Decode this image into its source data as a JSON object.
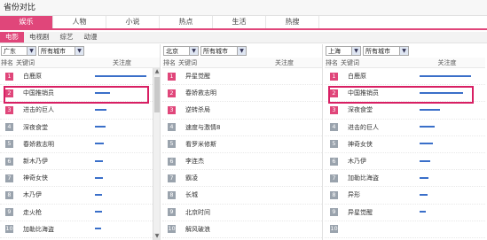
{
  "window": {
    "title": "省份对比"
  },
  "category_tabs": [
    {
      "label": "娱乐",
      "active": true
    },
    {
      "label": "人物",
      "active": false
    },
    {
      "label": "小说",
      "active": false
    },
    {
      "label": "热点",
      "active": false
    },
    {
      "label": "生活",
      "active": false
    },
    {
      "label": "热搜",
      "active": false
    }
  ],
  "sub_tabs": [
    {
      "label": "电影",
      "active": true
    },
    {
      "label": "电视剧",
      "active": false
    },
    {
      "label": "综艺",
      "active": false
    },
    {
      "label": "动漫",
      "active": false
    }
  ],
  "table_headers": {
    "rank": "排名",
    "keyword": "关键词",
    "attention": "关注度"
  },
  "colors": {
    "accent": "#e0467a",
    "bar": "#3a6fc9",
    "highlight": "#d81f63"
  },
  "panels": [
    {
      "province": "广东",
      "city": "所有城市",
      "has_scrollbar": true,
      "highlight_row": 1,
      "rows": [
        {
          "rank": "1",
          "keyword": "白鹿原",
          "attention": 1.0
        },
        {
          "rank": "2",
          "keyword": "中国推销员",
          "attention": 0.3
        },
        {
          "rank": "3",
          "keyword": "进击的巨人",
          "attention": 0.22
        },
        {
          "rank": "4",
          "keyword": "深夜食堂",
          "attention": 0.2
        },
        {
          "rank": "5",
          "keyword": "春娇救志明",
          "attention": 0.18
        },
        {
          "rank": "6",
          "keyword": "新木乃伊",
          "attention": 0.16
        },
        {
          "rank": "7",
          "keyword": "神奇女侠",
          "attention": 0.15
        },
        {
          "rank": "8",
          "keyword": "木乃伊",
          "attention": 0.14
        },
        {
          "rank": "9",
          "keyword": "走火枪",
          "attention": 0.13
        },
        {
          "rank": "10",
          "keyword": "加勒比海盗",
          "attention": 0.12
        }
      ]
    },
    {
      "province": "北京",
      "city": "所有城市",
      "has_scrollbar": false,
      "highlight_row": null,
      "rows": [
        {
          "rank": "1",
          "keyword": "异星觉醒",
          "attention": 0.0
        },
        {
          "rank": "2",
          "keyword": "春娇救志明",
          "attention": 0.0
        },
        {
          "rank": "3",
          "keyword": "逆转杀局",
          "attention": 0.0
        },
        {
          "rank": "4",
          "keyword": "速度与激情8",
          "attention": 0.0
        },
        {
          "rank": "5",
          "keyword": "看罗米修斯",
          "attention": 0.0
        },
        {
          "rank": "6",
          "keyword": "李连杰",
          "attention": 0.0
        },
        {
          "rank": "7",
          "keyword": "霸凌",
          "attention": 0.0
        },
        {
          "rank": "8",
          "keyword": "长城",
          "attention": 0.0
        },
        {
          "rank": "9",
          "keyword": "北京时间",
          "attention": 0.0
        },
        {
          "rank": "10",
          "keyword": "解风破浪",
          "attention": 0.0
        }
      ]
    },
    {
      "province": "上海",
      "city": "所有城市",
      "has_scrollbar": false,
      "highlight_row": 1,
      "rows": [
        {
          "rank": "1",
          "keyword": "白鹿原",
          "attention": 1.0
        },
        {
          "rank": "2",
          "keyword": "中国推销员",
          "attention": 0.85
        },
        {
          "rank": "3",
          "keyword": "深夜食堂",
          "attention": 0.4
        },
        {
          "rank": "4",
          "keyword": "进击的巨人",
          "attention": 0.3
        },
        {
          "rank": "5",
          "keyword": "神奇女侠",
          "attention": 0.25
        },
        {
          "rank": "6",
          "keyword": "木乃伊",
          "attention": 0.2
        },
        {
          "rank": "7",
          "keyword": "加勒比海盗",
          "attention": 0.18
        },
        {
          "rank": "8",
          "keyword": "异形",
          "attention": 0.16
        },
        {
          "rank": "9",
          "keyword": "异星觉醒",
          "attention": 0.12
        },
        {
          "rank": "10",
          "keyword": "",
          "attention": 0.0
        }
      ]
    }
  ]
}
